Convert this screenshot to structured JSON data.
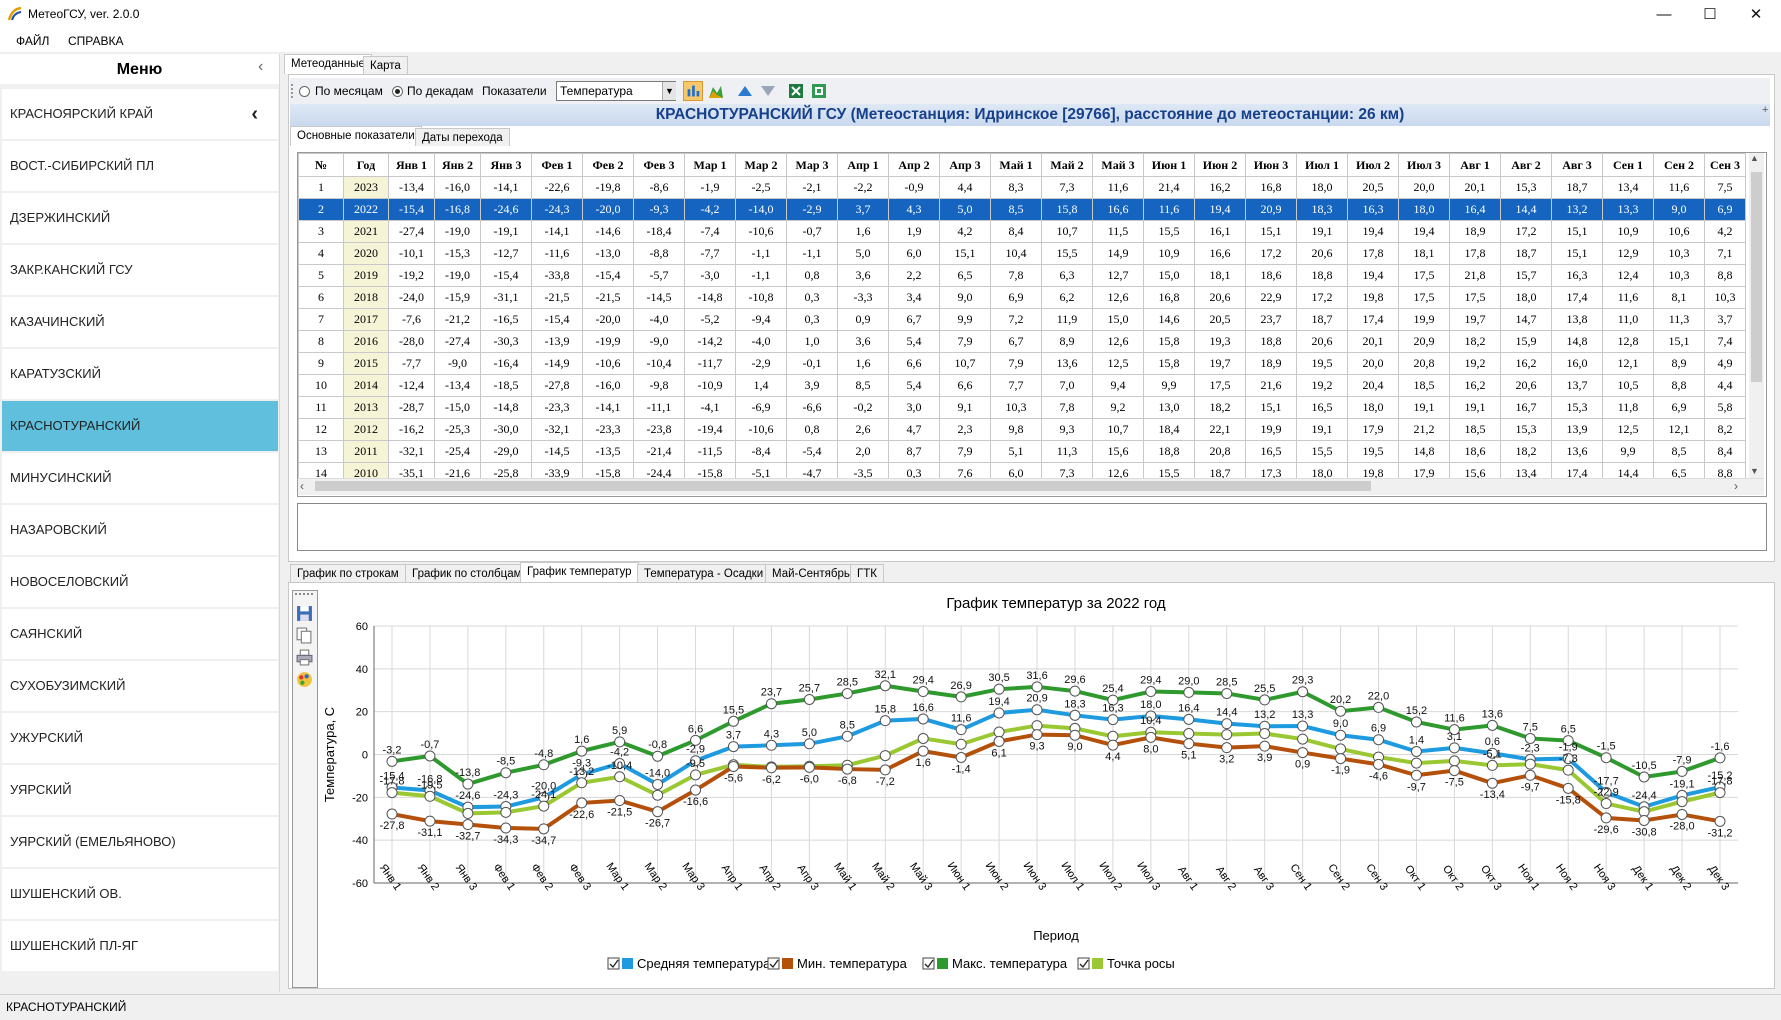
{
  "window": {
    "title": "МетеоГСУ, ver. 2.0.0",
    "minimize": "—",
    "maximize": "☐",
    "close": "✕"
  },
  "menubar": {
    "file": "ФАЙЛ",
    "help": "СПРАВКА"
  },
  "sidebar": {
    "header": "Меню",
    "collapse_icon": "‹",
    "items": [
      {
        "label": "КРАСНОЯРСКИЙ КРАЙ",
        "chevron": "‹"
      },
      {
        "label": "ВОСТ.-СИБИРСКИЙ ПЛ"
      },
      {
        "label": "ДЗЕРЖИНСКИЙ"
      },
      {
        "label": "ЗАКР.КАНСКИЙ ГСУ"
      },
      {
        "label": "КАЗАЧИНСКИЙ"
      },
      {
        "label": "КАРАТУЗСКИЙ"
      },
      {
        "label": "КРАСНОТУРАНСКИЙ",
        "selected": true
      },
      {
        "label": "МИНУСИНСКИЙ"
      },
      {
        "label": "НАЗАРОВСКИЙ"
      },
      {
        "label": "НОВОСЕЛОВСКИЙ"
      },
      {
        "label": "САЯНСКИЙ"
      },
      {
        "label": "СУХОБУЗИМСКИЙ"
      },
      {
        "label": "УЖУРСКИЙ"
      },
      {
        "label": "УЯРСКИЙ"
      },
      {
        "label": "УЯРСКИЙ (ЕМЕЛЬЯНОВО)"
      },
      {
        "label": "ШУШЕНСКИЙ ОВ."
      },
      {
        "label": "ШУШЕНСКИЙ ПЛ-ЯГ"
      }
    ]
  },
  "status": {
    "text": "КРАСНОТУРАНСКИЙ"
  },
  "tabs_top": [
    "Метеоданные",
    "Карта"
  ],
  "toolbar": {
    "radio_months": "По месяцам",
    "radio_decades": "По декадам",
    "indicators_label": "Показатели",
    "indicator_value": "Температура"
  },
  "banner": "КРАСНОТУРАНСКИЙ ГСУ (Метеостанция: Идринское [29766], расстояние до метеостанции: 26 км)",
  "subtabs": [
    "Основные показатели",
    "Даты перехода"
  ],
  "table": {
    "columns": [
      "№",
      "Год",
      "Янв 1",
      "Янв 2",
      "Янв 3",
      "Фев 1",
      "Фев 2",
      "Фев 3",
      "Мар 1",
      "Мар 2",
      "Мар 3",
      "Апр 1",
      "Апр 2",
      "Апр 3",
      "Май 1",
      "Май 2",
      "Май 3",
      "Июн 1",
      "Июн 2",
      "Июн 3",
      "Июл 1",
      "Июл 2",
      "Июл 3",
      "Авг 1",
      "Авг 2",
      "Авг 3",
      "Сен 1",
      "Сен 2",
      "Сен 3"
    ],
    "rows": [
      [
        "1",
        "2023",
        "-13,4",
        "-16,0",
        "-14,1",
        "-22,6",
        "-19,8",
        "-8,6",
        "-1,9",
        "-2,5",
        "-2,1",
        "-2,2",
        "-0,9",
        "4,4",
        "8,3",
        "7,3",
        "11,6",
        "21,4",
        "16,2",
        "16,8",
        "18,0",
        "20,5",
        "20,0",
        "20,1",
        "15,3",
        "18,7",
        "13,4",
        "11,6",
        "7,5"
      ],
      [
        "2",
        "2022",
        "-15,4",
        "-16,8",
        "-24,6",
        "-24,3",
        "-20,0",
        "-9,3",
        "-4,2",
        "-14,0",
        "-2,9",
        "3,7",
        "4,3",
        "5,0",
        "8,5",
        "15,8",
        "16,6",
        "11,6",
        "19,4",
        "20,9",
        "18,3",
        "16,3",
        "18,0",
        "16,4",
        "14,4",
        "13,2",
        "13,3",
        "9,0",
        "6,9"
      ],
      [
        "3",
        "2021",
        "-27,4",
        "-19,0",
        "-19,1",
        "-14,1",
        "-14,6",
        "-18,4",
        "-7,4",
        "-10,6",
        "-0,7",
        "1,6",
        "1,9",
        "4,2",
        "8,4",
        "10,7",
        "11,5",
        "15,5",
        "16,1",
        "15,1",
        "19,1",
        "19,4",
        "19,4",
        "18,9",
        "17,2",
        "15,1",
        "10,9",
        "10,6",
        "4,2"
      ],
      [
        "4",
        "2020",
        "-10,1",
        "-15,3",
        "-12,7",
        "-11,6",
        "-13,0",
        "-8,8",
        "-7,7",
        "-1,1",
        "-1,1",
        "5,0",
        "6,0",
        "15,1",
        "10,4",
        "15,5",
        "14,9",
        "10,9",
        "16,6",
        "17,2",
        "20,6",
        "17,8",
        "18,1",
        "17,8",
        "18,7",
        "15,1",
        "12,9",
        "10,3",
        "7,1"
      ],
      [
        "5",
        "2019",
        "-19,2",
        "-19,0",
        "-15,4",
        "-33,8",
        "-15,4",
        "-5,7",
        "-3,0",
        "-1,1",
        "0,8",
        "3,6",
        "2,2",
        "6,5",
        "7,8",
        "6,3",
        "12,7",
        "15,0",
        "18,1",
        "18,6",
        "18,8",
        "19,4",
        "17,5",
        "21,8",
        "15,7",
        "16,3",
        "12,4",
        "10,3",
        "8,8"
      ],
      [
        "6",
        "2018",
        "-24,0",
        "-15,9",
        "-31,1",
        "-21,5",
        "-21,5",
        "-14,5",
        "-14,8",
        "-10,8",
        "0,3",
        "-3,3",
        "3,4",
        "9,0",
        "6,9",
        "6,2",
        "12,6",
        "16,8",
        "20,6",
        "22,9",
        "17,2",
        "19,8",
        "17,5",
        "17,5",
        "18,0",
        "17,4",
        "11,6",
        "8,1",
        "10,3"
      ],
      [
        "7",
        "2017",
        "-7,6",
        "-21,2",
        "-16,5",
        "-15,4",
        "-20,0",
        "-4,0",
        "-5,2",
        "-9,4",
        "0,3",
        "0,9",
        "6,7",
        "9,9",
        "7,2",
        "11,9",
        "15,0",
        "14,6",
        "20,5",
        "23,7",
        "18,7",
        "17,4",
        "19,9",
        "19,7",
        "14,7",
        "13,8",
        "11,0",
        "11,3",
        "3,7"
      ],
      [
        "8",
        "2016",
        "-28,0",
        "-27,4",
        "-30,3",
        "-13,9",
        "-19,9",
        "-9,0",
        "-14,2",
        "-4,0",
        "1,0",
        "3,6",
        "5,4",
        "7,9",
        "6,7",
        "8,9",
        "12,6",
        "15,8",
        "19,3",
        "18,8",
        "20,6",
        "20,1",
        "20,9",
        "18,2",
        "15,9",
        "14,8",
        "12,8",
        "15,1",
        "7,4"
      ],
      [
        "9",
        "2015",
        "-7,7",
        "-9,0",
        "-16,4",
        "-14,9",
        "-10,6",
        "-10,4",
        "-11,7",
        "-2,9",
        "-0,1",
        "1,6",
        "6,6",
        "10,7",
        "7,9",
        "13,6",
        "12,5",
        "15,8",
        "19,7",
        "18,9",
        "19,5",
        "20,0",
        "20,8",
        "19,2",
        "16,2",
        "16,0",
        "12,1",
        "8,9",
        "4,9"
      ],
      [
        "10",
        "2014",
        "-12,4",
        "-13,4",
        "-18,5",
        "-27,8",
        "-16,0",
        "-9,8",
        "-10,9",
        "1,4",
        "3,9",
        "8,5",
        "5,4",
        "6,6",
        "7,7",
        "7,0",
        "9,4",
        "9,9",
        "17,5",
        "21,6",
        "19,2",
        "20,4",
        "18,5",
        "16,2",
        "20,6",
        "13,7",
        "10,5",
        "8,8",
        "4,4"
      ],
      [
        "11",
        "2013",
        "-28,7",
        "-15,0",
        "-14,8",
        "-23,3",
        "-14,1",
        "-11,1",
        "-4,1",
        "-6,9",
        "-6,6",
        "-0,2",
        "3,0",
        "9,1",
        "10,3",
        "7,8",
        "9,2",
        "13,0",
        "18,2",
        "15,1",
        "16,5",
        "18,0",
        "19,1",
        "19,1",
        "16,7",
        "15,3",
        "11,8",
        "6,9",
        "5,8"
      ],
      [
        "12",
        "2012",
        "-16,2",
        "-25,3",
        "-30,0",
        "-32,1",
        "-23,3",
        "-23,8",
        "-19,4",
        "-10,6",
        "0,8",
        "2,6",
        "4,7",
        "2,3",
        "9,8",
        "9,3",
        "10,7",
        "18,4",
        "22,1",
        "19,9",
        "19,1",
        "17,9",
        "21,2",
        "18,5",
        "15,3",
        "13,9",
        "12,5",
        "12,1",
        "8,2"
      ],
      [
        "13",
        "2011",
        "-32,1",
        "-25,4",
        "-29,0",
        "-14,5",
        "-13,5",
        "-21,4",
        "-11,5",
        "-8,4",
        "-5,4",
        "2,0",
        "8,7",
        "7,9",
        "5,1",
        "11,3",
        "15,6",
        "18,8",
        "20,8",
        "16,5",
        "15,5",
        "19,5",
        "14,8",
        "18,6",
        "18,2",
        "13,6",
        "9,9",
        "8,5",
        "8,4"
      ],
      [
        "14",
        "2010",
        "-35,1",
        "-21,6",
        "-25,8",
        "-33,9",
        "-15,8",
        "-24,4",
        "-15,8",
        "-5,1",
        "-4,7",
        "-3,5",
        "0,3",
        "7,6",
        "6,0",
        "7,3",
        "12,6",
        "15,5",
        "18,7",
        "17,3",
        "18,0",
        "19,8",
        "17,9",
        "15,6",
        "13,4",
        "17,4",
        "14,4",
        "6,5",
        "8,8"
      ]
    ]
  },
  "tabs_bottom": [
    "График по строкам",
    "График по столбцам",
    "График температур",
    "Температура - Осадки",
    "Май-Сентябрь",
    "ГТК"
  ],
  "chart_icons": [
    "save-icon",
    "copy-icon",
    "print-icon",
    "palette-icon"
  ],
  "chart_data": {
    "type": "line",
    "title": "График температур за 2022 год",
    "xlabel": "Период",
    "ylabel": "Температура, С",
    "ylim": [
      -60,
      60
    ],
    "yticks": [
      "60",
      "40",
      "20",
      "0",
      "-20",
      "-40",
      "-60"
    ],
    "grid": true,
    "legend_position": "bottom",
    "categories": [
      "Янв 1",
      "Янв 2",
      "Янв 3",
      "Фев 1",
      "Фев 2",
      "Фев 3",
      "Мар 1",
      "Мар 2",
      "Мар 3",
      "Апр 1",
      "Апр 2",
      "Апр 3",
      "Май 1",
      "Май 2",
      "Май 3",
      "Июн 1",
      "Июн 2",
      "Июн 3",
      "Июл 1",
      "Июл 2",
      "Июл 3",
      "Авг 1",
      "Авг 2",
      "Авг 3",
      "Сен 1",
      "Сен 2",
      "Сен 3",
      "Окт 1",
      "Окт 2",
      "Окт 3",
      "Ноя 1",
      "Ноя 2",
      "Ноя 3",
      "Дек 1",
      "Дек 2",
      "Дек 3"
    ],
    "series": [
      {
        "name": "Средняя температура",
        "color": "#1e9be0",
        "values": [
          -15.4,
          -16.8,
          -24.6,
          -24.3,
          -20.0,
          -9.3,
          -4.2,
          -14.0,
          -2.9,
          3.7,
          4.3,
          5.0,
          8.5,
          15.8,
          16.6,
          11.6,
          19.4,
          20.9,
          18.3,
          16.3,
          18.0,
          16.4,
          14.4,
          13.2,
          13.3,
          9.0,
          6.9,
          1.4,
          3.1,
          0.6,
          -2.3,
          -1.9,
          -17.7,
          -24.4,
          -19.1,
          -15.2
        ],
        "labels": [
          "-15,4",
          "-16,8",
          "-24,6",
          "-24,3",
          "-20,0",
          "-9,3",
          "-4,2",
          "-14,0",
          "-2,9",
          "3,7",
          "4,3",
          "5,0",
          "8,5",
          "15,8",
          "16,6",
          "11,6",
          "19,4",
          "20,9",
          "18,3",
          "16,3",
          "18,0",
          "16,4",
          "14,4",
          "13,2",
          "13,3",
          "9,0",
          "6,9",
          "1,4",
          "3,1",
          "0,6",
          "-2,3",
          "-1,9",
          "-17,7",
          "-24,4",
          "-19,1",
          "-15,2"
        ]
      },
      {
        "name": "Мин. температура",
        "color": "#b5500a",
        "values": [
          -27.8,
          -31.1,
          -32.7,
          -34.3,
          -34.7,
          -22.6,
          -21.5,
          -26.7,
          -16.6,
          -5.6,
          -6.2,
          -6.0,
          -6.8,
          -7.2,
          1.6,
          -1.4,
          6.1,
          9.3,
          9.0,
          4.4,
          8.0,
          5.1,
          3.2,
          3.9,
          0.9,
          -1.9,
          -4.6,
          -9.7,
          -7.5,
          -13.4,
          -9.7,
          -15.8,
          -29.6,
          -30.8,
          -28.0,
          -31.2
        ],
        "labels": [
          "-27,8",
          "-31,1",
          "-32,7",
          "-34,3",
          "-34,7",
          "-22,6",
          "-21,5",
          "-26,7",
          "-16,6",
          "-5,6",
          "-6,2",
          "-6,0",
          "-6,8",
          "-7,2",
          "1,6",
          "-1,4",
          "6,1",
          "9,3",
          "9,0",
          "4,4",
          "8,0",
          "5,1",
          "3,2",
          "3,9",
          "0,9",
          "-1,9",
          "-4,6",
          "-9,7",
          "-7,5",
          "-13,4",
          "-9,7",
          "-15,8",
          "-29,6",
          "-30,8",
          "-28,0",
          "-31,2"
        ]
      },
      {
        "name": "Макс. температура",
        "color": "#2e9a2e",
        "values": [
          -3.2,
          -0.7,
          -13.8,
          -8.5,
          -4.8,
          1.6,
          5.9,
          -0.8,
          6.6,
          15.5,
          23.7,
          25.7,
          28.5,
          32.1,
          29.4,
          26.9,
          30.5,
          31.6,
          29.6,
          25.4,
          29.4,
          29.0,
          28.5,
          25.5,
          29.3,
          20.2,
          22.0,
          15.2,
          11.6,
          13.6,
          7.5,
          6.5,
          -1.5,
          -10.5,
          -7.9,
          -1.6
        ],
        "labels": [
          "-3,2",
          "-0,7",
          "-13,8",
          "-8,5",
          "-4,8",
          "1,6",
          "5,9",
          "-0,8",
          "6,6",
          "15,5",
          "23,7",
          "25,7",
          "28,5",
          "32,1",
          "29,4",
          "26,9",
          "30,5",
          "31,6",
          "29,6",
          "25,4",
          "29,4",
          "29,0",
          "28,5",
          "25,5",
          "29,3",
          "20,2",
          "22,0",
          "15,2",
          "11,6",
          "13,6",
          "7,5",
          "6,5",
          "-1,5",
          "-10,5",
          "-7,9",
          "-1,6"
        ]
      },
      {
        "name": "Точка росы",
        "color": "#9ac832",
        "values": [
          -17.8,
          -19.5,
          -27.5,
          -27.0,
          -24.1,
          -13.2,
          -10.4,
          -19.0,
          -9.5,
          -4.8,
          -5.8,
          -5.5,
          -5.0,
          -0.5,
          7.5,
          4.8,
          10.5,
          13.5,
          12.2,
          8.5,
          10.4,
          9.8,
          9.3,
          9.8,
          7.2,
          2.6,
          -1.2,
          -4.0,
          -3.0,
          -5.1,
          -4.5,
          -7.3,
          -22.9,
          -26.7,
          -22.0,
          -17.8
        ],
        "labels": [
          "-17,8",
          "-19,5",
          "",
          "",
          "-24,1",
          "-13,2",
          "-10,4",
          "",
          "-9,5",
          "",
          "",
          "",
          "",
          "",
          "",
          "",
          "",
          "",
          "",
          "",
          "10,4",
          "",
          "",
          "",
          "",
          "",
          "",
          "",
          "",
          "-5,1",
          "",
          "-7,3",
          "-22,9",
          "",
          "",
          "-17,8"
        ]
      }
    ]
  }
}
